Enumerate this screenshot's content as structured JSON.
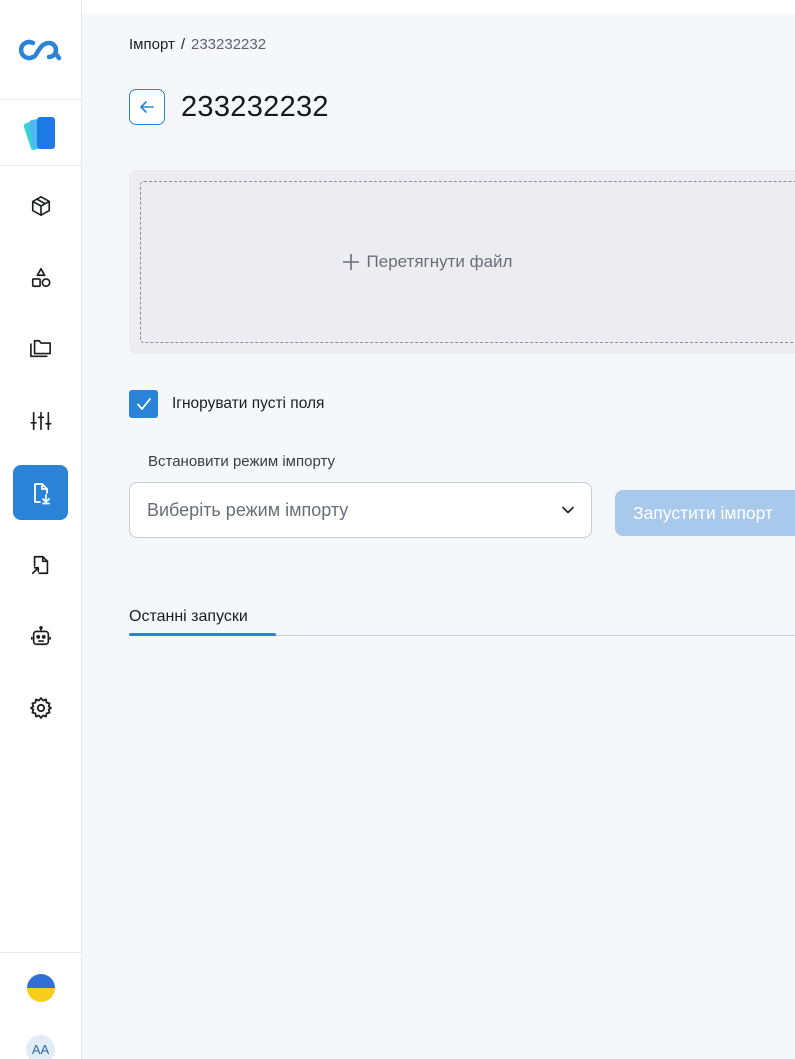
{
  "sidebar": {
    "logo_icon": "infinity-logo-icon",
    "app_icon": "cards-app-icon",
    "items": [
      {
        "icon": "cube-icon",
        "active": false
      },
      {
        "icon": "shapes-icon",
        "active": false
      },
      {
        "icon": "folders-icon",
        "active": false
      },
      {
        "icon": "sliders-icon",
        "active": false
      },
      {
        "icon": "file-import-icon",
        "active": true
      },
      {
        "icon": "file-export-icon",
        "active": false
      },
      {
        "icon": "robot-icon",
        "active": false
      },
      {
        "icon": "gear-icon",
        "active": false
      }
    ],
    "language_flag": "ukraine-flag-icon",
    "avatar_initials": "AA"
  },
  "header": {
    "breadcrumb": {
      "parent": "Імпорт",
      "separator": "/",
      "current": "233232232"
    },
    "title": "233232232"
  },
  "dropzone": {
    "label": "Перетягнути файл",
    "icon": "plus-icon"
  },
  "options": {
    "ignore_empty": {
      "label": "Ігнорувати пусті поля",
      "checked": true
    }
  },
  "import_mode": {
    "label": "Встановити режим імпорту",
    "placeholder": "Виберіть режим імпорту"
  },
  "run_button": {
    "label": "Запустити імпорт"
  },
  "tabs": [
    {
      "label": "Останні запуски",
      "active": true
    }
  ],
  "colors": {
    "accent": "#2b83d8",
    "button_disabled": "#a8c8ec",
    "page_bg": "#f6f7fb"
  }
}
